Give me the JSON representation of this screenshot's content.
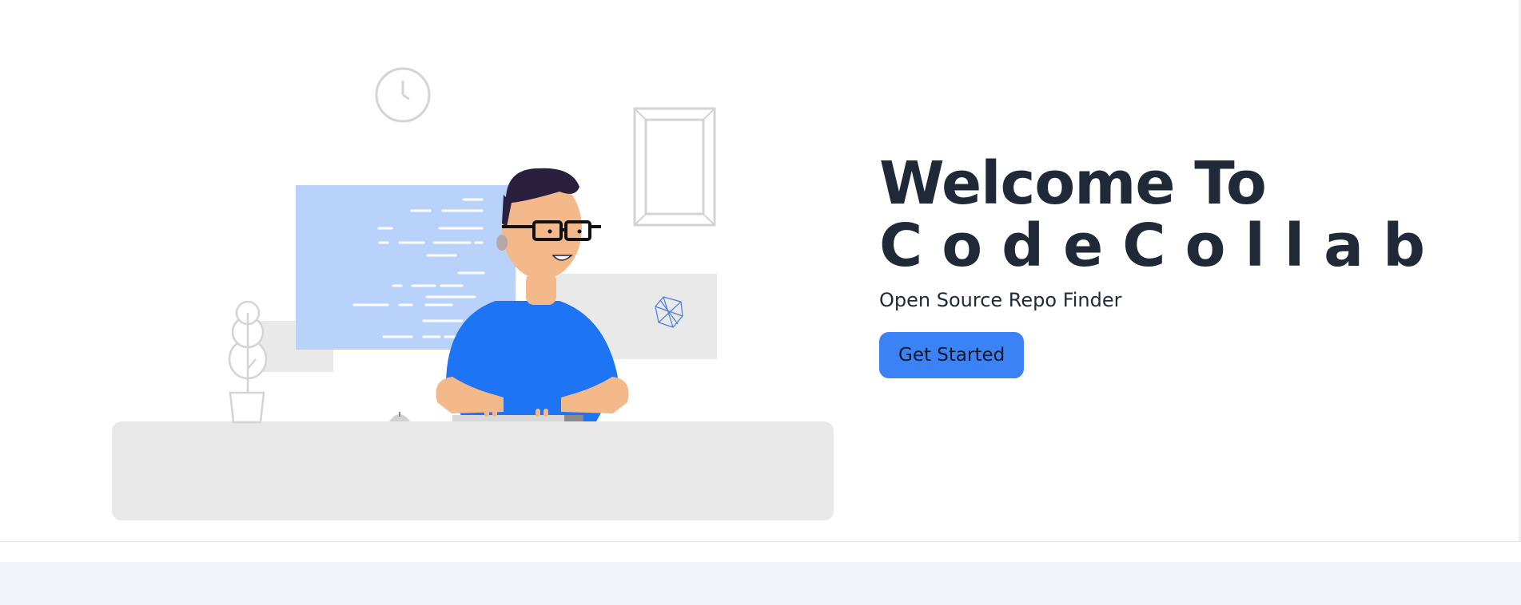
{
  "hero": {
    "title_line1": "Welcome To",
    "title_line2": "CodeCollab",
    "subtitle": "Open Source Repo Finder",
    "cta_label": "Get Started"
  },
  "colors": {
    "title": "#1f2937",
    "button": "#3b82f6",
    "shirt": "#1d74f5",
    "skin": "#f4b98a",
    "hair": "#2a1f3d",
    "screen": "#b9d2fb",
    "desk": "#e8e8e8",
    "footer_band": "#f0f3f8"
  },
  "illustration": {
    "icons": [
      "clock-icon",
      "picture-frame-icon",
      "plant-icon",
      "mouse-icon",
      "keyboard-icon",
      "code-screen-icon",
      "developer-figure"
    ]
  }
}
